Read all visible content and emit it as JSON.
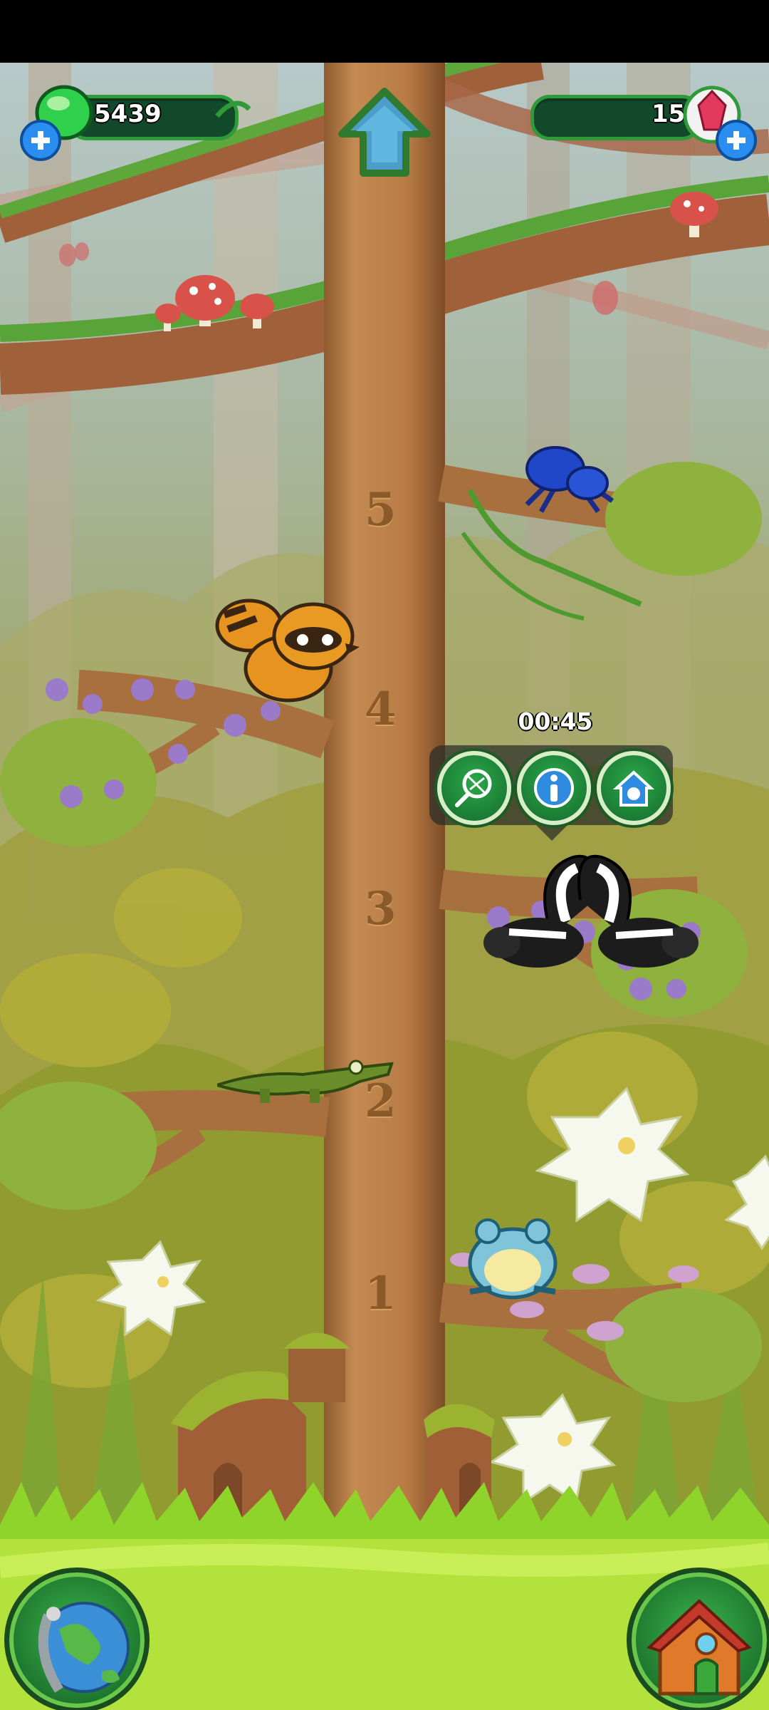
{
  "hud": {
    "coins": "5439",
    "coins_icon": "green-gem-icon",
    "gems": "15",
    "gems_icon": "red-crystal-icon",
    "add_icon": "plus-icon",
    "up_icon": "up-arrow-icon"
  },
  "tree": {
    "levels": [
      "5",
      "4",
      "3",
      "2",
      "1"
    ]
  },
  "animals": [
    {
      "name": "spider",
      "level": "5"
    },
    {
      "name": "raccoon-dog",
      "level": "4"
    },
    {
      "name": "skunks",
      "level": "3"
    },
    {
      "name": "crocodile",
      "level": "2"
    },
    {
      "name": "frog",
      "level": "1"
    }
  ],
  "popup": {
    "timer": "00:45",
    "actions": [
      "net-icon",
      "info-icon",
      "home-pet-icon"
    ]
  },
  "bottom": {
    "left_icon": "globe-icon",
    "right_icon": "house-icon"
  },
  "colors": {
    "hud_green": "#2e9a39",
    "hud_dark": "#12492b",
    "trunk": "#b77a45",
    "grass": "#9fd62a"
  }
}
